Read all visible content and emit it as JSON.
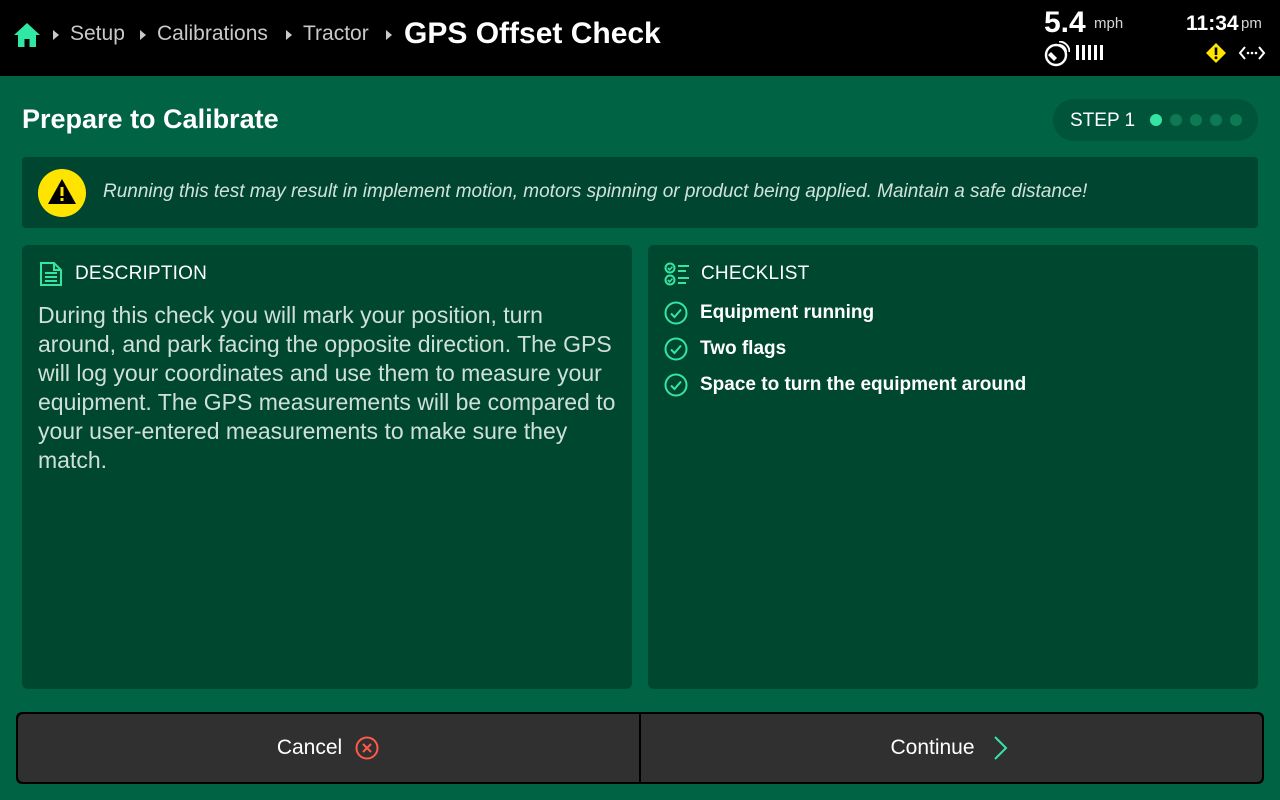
{
  "header": {
    "breadcrumbs": [
      "Setup",
      "Calibrations",
      "Tractor"
    ],
    "title": "GPS Offset Check",
    "speed": {
      "value": "5.4",
      "unit": "mph"
    },
    "clock": {
      "time": "11:34",
      "ampm": "pm"
    },
    "icons": [
      "home-icon",
      "gps-satellite-icon",
      "signal-bars-icon",
      "warning-diamond-icon",
      "connection-arrows-icon"
    ]
  },
  "section": {
    "title": "Prepare to Calibrate",
    "step_label": "STEP 1",
    "step_current": 1,
    "step_total": 5
  },
  "warning": {
    "text": "Running this test may result in implement motion, motors spinning or product being applied. Maintain a safe distance!"
  },
  "description": {
    "heading": "DESCRIPTION",
    "body": "During this check you will mark your position, turn around, and park facing the opposite direction. The GPS will log your coordinates and use them to measure your equipment. The GPS measurements will be compared to your user-entered measurements to make sure they match."
  },
  "checklist": {
    "heading": "CHECKLIST",
    "items": [
      {
        "label": "Equipment running"
      },
      {
        "label": "Two flags"
      },
      {
        "label": "Space to turn the equipment around"
      }
    ]
  },
  "footer": {
    "cancel_label": "Cancel",
    "continue_label": "Continue"
  },
  "colors": {
    "background": "#006343",
    "topbar": "#000000",
    "panel": "#00472f",
    "accent": "#35e5a4",
    "warning_yellow": "#ffe400",
    "cancel_red": "#ff5a4a",
    "button": "#303030"
  }
}
